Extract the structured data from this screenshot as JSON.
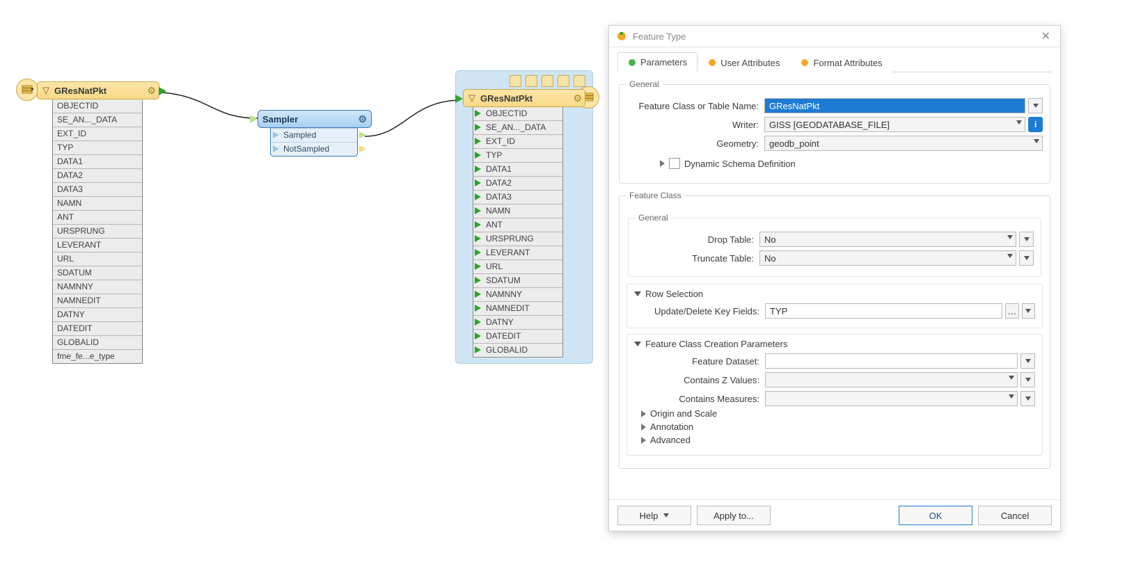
{
  "reader": {
    "title": "GResNatPkt",
    "attrs": [
      "OBJECTID",
      "SE_AN..._DATA",
      "EXT_ID",
      "TYP",
      "DATA1",
      "DATA2",
      "DATA3",
      "NAMN",
      "ANT",
      "URSPRUNG",
      "LEVERANT",
      "URL",
      "SDATUM",
      "NAMNNY",
      "NAMNEDIT",
      "DATNY",
      "DATEDIT",
      "GLOBALID",
      "fme_fe...e_type"
    ]
  },
  "transformer": {
    "title": "Sampler",
    "ports": [
      "Sampled",
      "NotSampled"
    ]
  },
  "writer": {
    "title": "GResNatPkt",
    "attrs": [
      "OBJECTID",
      "SE_AN..._DATA",
      "EXT_ID",
      "TYP",
      "DATA1",
      "DATA2",
      "DATA3",
      "NAMN",
      "ANT",
      "URSPRUNG",
      "LEVERANT",
      "URL",
      "SDATUM",
      "NAMNNY",
      "NAMNEDIT",
      "DATNY",
      "DATEDIT",
      "GLOBALID"
    ]
  },
  "dialog": {
    "title": "Feature Type",
    "tabs": {
      "parameters": "Parameters",
      "user_attributes": "User Attributes",
      "format_attributes": "Format Attributes"
    },
    "general_legend": "General",
    "fc_name_label": "Feature Class or Table Name:",
    "fc_name_value": "GResNatPkt",
    "writer_label": "Writer:",
    "writer_value": "GISS [GEODATABASE_FILE]",
    "geometry_label": "Geometry:",
    "geometry_value": "geodb_point",
    "dyn_schema": "Dynamic Schema Definition",
    "fc_legend": "Feature Class",
    "fc_general": "General",
    "drop_label": "Drop Table:",
    "drop_value": "No",
    "trunc_label": "Truncate Table:",
    "trunc_value": "No",
    "row_sel": "Row Selection",
    "key_fields_label": "Update/Delete Key Fields:",
    "key_fields_value": "TYP",
    "fc_create": "Feature Class Creation Parameters",
    "feat_dataset": "Feature Dataset:",
    "contains_z": "Contains Z Values:",
    "contains_m": "Contains Measures:",
    "origin_scale": "Origin and Scale",
    "annotation": "Annotation",
    "advanced": "Advanced",
    "footer": {
      "help": "Help",
      "apply": "Apply to...",
      "ok": "OK",
      "cancel": "Cancel"
    }
  }
}
